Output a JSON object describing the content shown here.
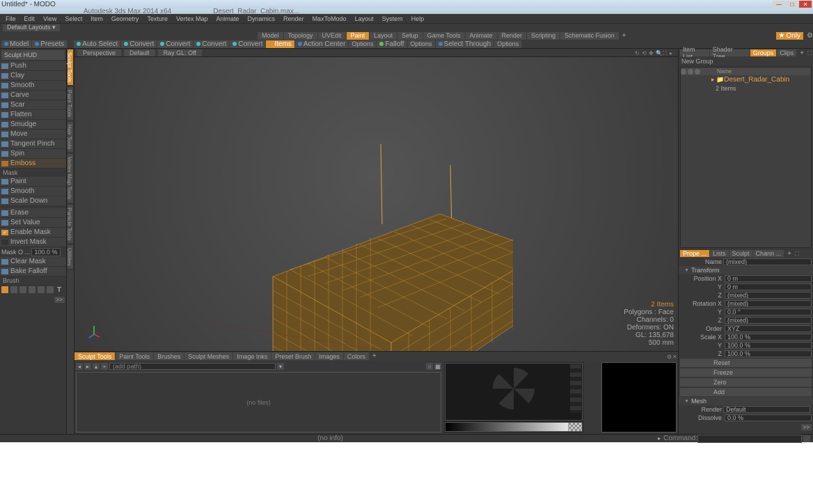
{
  "title": "Untitled* - MODO",
  "faint_tabs": {
    "a": "Autodesk 3ds Max 2014 x64",
    "b": "Desert_Radar_Cabin.max..."
  },
  "menu": [
    "File",
    "Edit",
    "View",
    "Select",
    "Item",
    "Geometry",
    "Texture",
    "Vertex Map",
    "Animate",
    "Dynamics",
    "Render",
    "MaxToModo",
    "Layout",
    "System",
    "Help"
  ],
  "layout_dropdown": "Default Layouts ▾",
  "tabs": [
    "Model",
    "Topology",
    "UVEdit",
    "Paint",
    "Layout",
    "Setup",
    "Game Tools",
    "Animate",
    "Render",
    "Scripting",
    "Schematic Fusion"
  ],
  "tabs_active_index": 3,
  "toolbar2": {
    "model": "Model",
    "presets": "Presets",
    "auto_select": "Auto Select",
    "convert": "Convert",
    "items": "Items",
    "action_center": "Action Center",
    "options1": "Options",
    "falloff": "Falloff",
    "options2": "Options",
    "select_through": "Select Through",
    "options3": "Options",
    "only": "Only"
  },
  "vtabs": [
    "Sculpt Tools",
    "Paint Tools",
    "Hair Tools",
    "Vertex Map Tools",
    "Particle Tools",
    "Utilities"
  ],
  "left": {
    "header": "Sculpt HUD",
    "tools": [
      "Push",
      "Clay",
      "Smooth",
      "Carve",
      "Scar",
      "Flatten",
      "Smudge",
      "Move",
      "Tangent Pinch",
      "Spin",
      "Emboss"
    ],
    "mask_label": "Mask",
    "mask_tools": [
      "Paint",
      "Smooth",
      "Scale Down"
    ],
    "erase_tools": [
      "Erase",
      "Set Value"
    ],
    "enable_mask": "Enable Mask",
    "invert_mask": "Invert Mask",
    "mask_o_label": "Mask O ...",
    "mask_o_value": "100.0 %",
    "clear_mask": "Clear Mask",
    "bake_falloff": "Bake Falloff",
    "brush_label": "Brush"
  },
  "viewport": {
    "perspective": "Perspective",
    "default": "Default",
    "raygl": "Ray GL: Off",
    "info": {
      "items": "2 Items",
      "polygons": "Polygons : Face",
      "channels": "Channels: 0",
      "deformers": "Deformers: ON",
      "gl": "GL: 135,678",
      "scale": "500 mm"
    }
  },
  "bottom_tabs": [
    "Sculpt Tools",
    "Paint Tools",
    "Brushes",
    "Sculpt Meshes",
    "Image Inks",
    "Preset Brush",
    "Images",
    "Colors"
  ],
  "file_browser": {
    "path": "(add path)",
    "empty": "(no files)"
  },
  "status": {
    "info": "(no info)",
    "command": "Command:"
  },
  "right": {
    "tabs1": [
      "Item List",
      "Shader Tree",
      "Groups",
      "Clips"
    ],
    "tabs1_active": 2,
    "new_group": "New Group",
    "col_name": "Name",
    "item": "Desert_Radar_Cabin",
    "item_count": "2 Items",
    "tabs2": [
      "Prope ...",
      "Lists",
      "Sculpt",
      "Chann ..."
    ],
    "tabs2_active": 0,
    "name_label": "Name",
    "name_value": "(mixed)",
    "transform_label": "Transform",
    "position_label": "Position X",
    "pos_x": "0 m",
    "pos_y": "0 m",
    "pos_z": "(mixed)",
    "rotation_label": "Rotation X",
    "rot_x": "(mixed)",
    "rot_y": "0.0 °",
    "rot_z": "(mixed)",
    "order_label": "Order",
    "order_value": "XYZ",
    "scale_label": "Scale X",
    "scale_x": "100.0 %",
    "scale_y": "100.0 %",
    "scale_z": "100.0 %",
    "actions": [
      "Reset",
      "Freeze",
      "Zero",
      "Add"
    ],
    "mesh_label": "Mesh",
    "render_label": "Render",
    "render_value": "Default",
    "dissolve_label": "Dissolve",
    "dissolve_value": "0.0 %"
  }
}
